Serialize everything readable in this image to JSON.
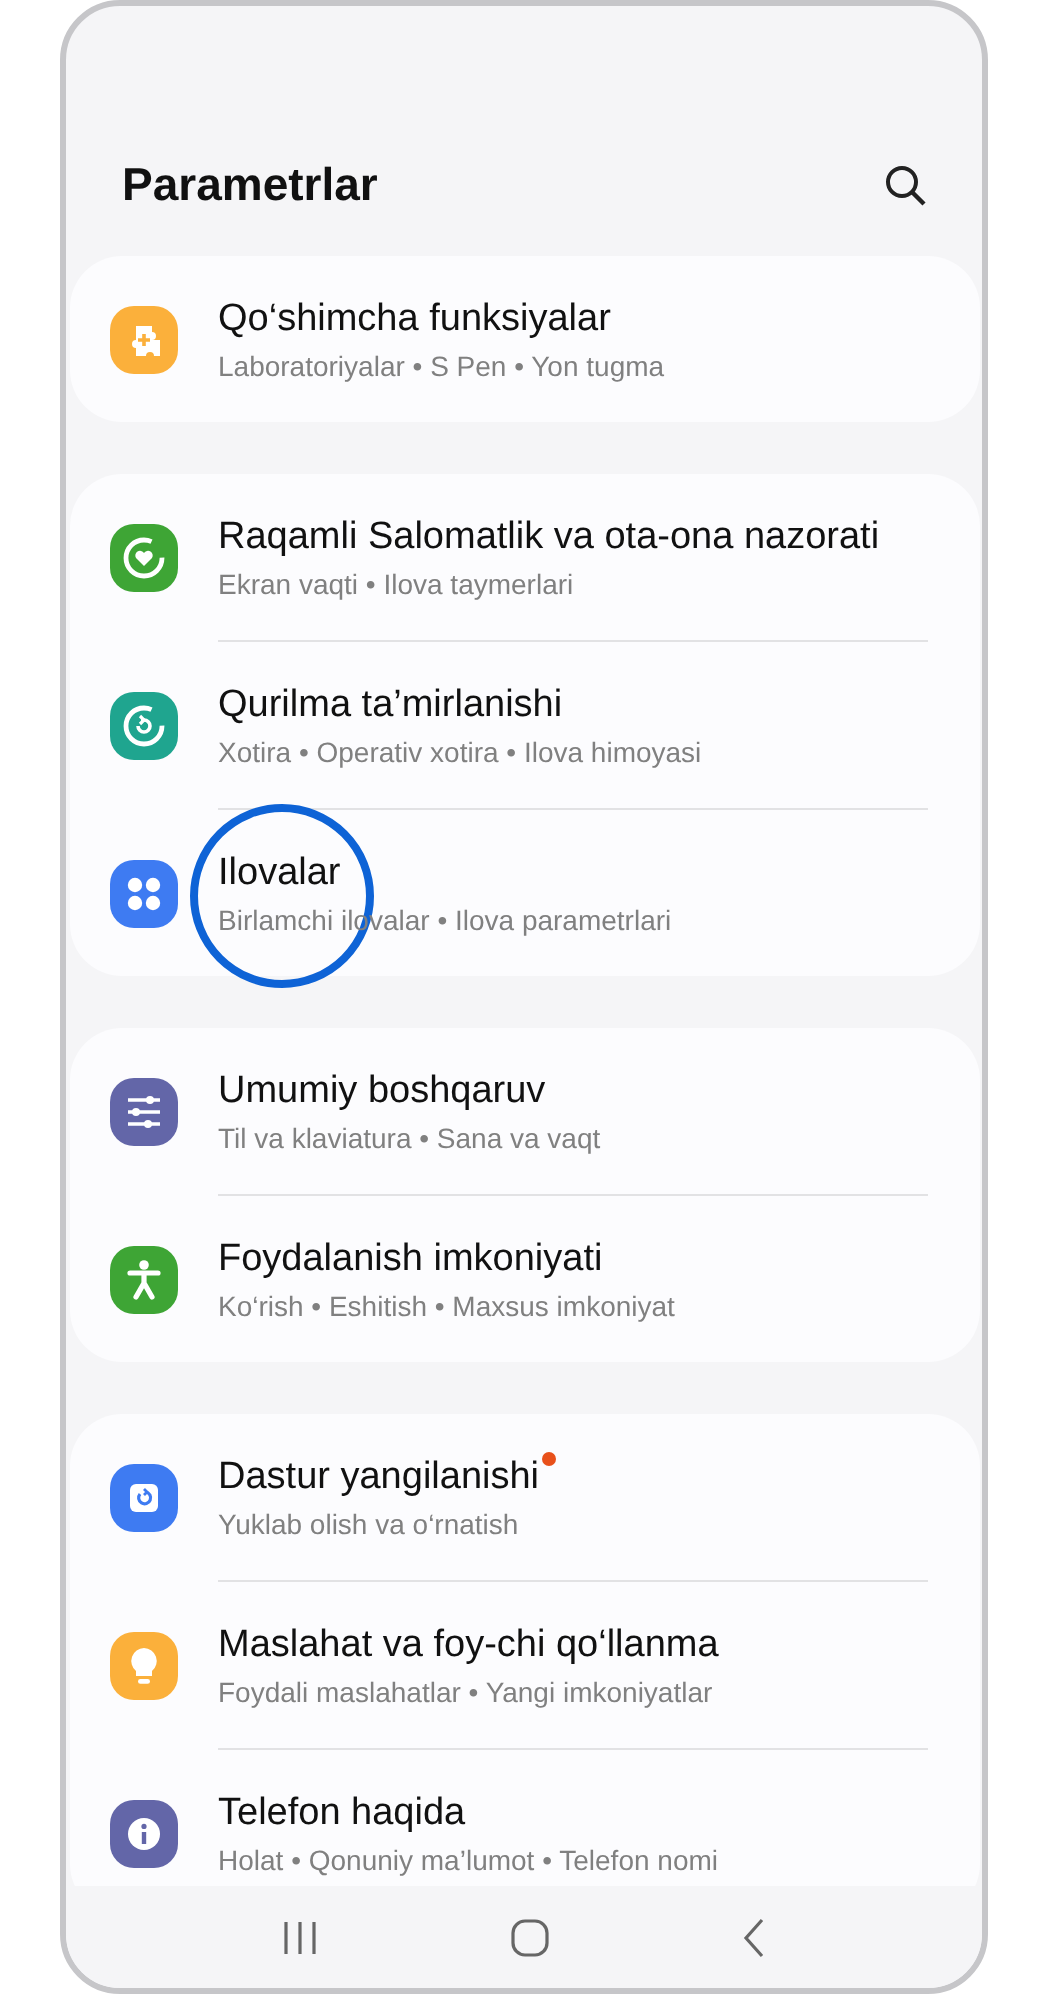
{
  "header": {
    "title": "Parametrlar"
  },
  "groups": [
    {
      "items": [
        {
          "kind": "puzzle",
          "color": "#fbb03b",
          "title": "Qo‘shimcha funksiyalar",
          "subtitle": "Laboratoriyalar • S Pen • Yon tugma",
          "badge": false,
          "highlighted": false
        }
      ]
    },
    {
      "items": [
        {
          "kind": "heart-ring",
          "color": "#3ea535",
          "title": "Raqamli Salomatlik va ota-ona nazorati",
          "subtitle": "Ekran vaqti • Ilova taymerlari",
          "badge": false,
          "highlighted": false
        },
        {
          "kind": "refresh-ring",
          "color": "#1fa58f",
          "title": "Qurilma ta’mirlanishi",
          "subtitle": "Xotira • Operativ xotira • Ilova himoyasi",
          "badge": false,
          "highlighted": false
        },
        {
          "kind": "dots",
          "color": "#3e7bf2",
          "title": "Ilovalar",
          "subtitle": "Birlamchi ilovalar • Ilova parametrlari",
          "badge": false,
          "highlighted": true
        }
      ]
    },
    {
      "items": [
        {
          "kind": "sliders",
          "color": "#6366a8",
          "title": "Umumiy boshqaruv",
          "subtitle": "Til va klaviatura • Sana va vaqt",
          "badge": false,
          "highlighted": false
        },
        {
          "kind": "person",
          "color": "#3ea535",
          "title": "Foydalanish imkoniyati",
          "subtitle": "Ko‘rish • Eshitish • Maxsus imkoniyat",
          "badge": false,
          "highlighted": false
        }
      ]
    },
    {
      "items": [
        {
          "kind": "update",
          "color": "#3e7bf2",
          "title": "Dastur yangilanishi",
          "subtitle": "Yuklab olish va o‘rnatish",
          "badge": true,
          "highlighted": false
        },
        {
          "kind": "bulb",
          "color": "#fbb03b",
          "title": "Maslahat va foy-chi qo‘llanma",
          "subtitle": "Foydali maslahatlar • Yangi imkoniyatlar",
          "badge": false,
          "highlighted": false
        },
        {
          "kind": "info",
          "color": "#6366a8",
          "title": "Telefon haqida",
          "subtitle": "Holat • Qonuniy ma’lumot • Telefon nomi",
          "badge": false,
          "highlighted": false
        }
      ]
    }
  ]
}
